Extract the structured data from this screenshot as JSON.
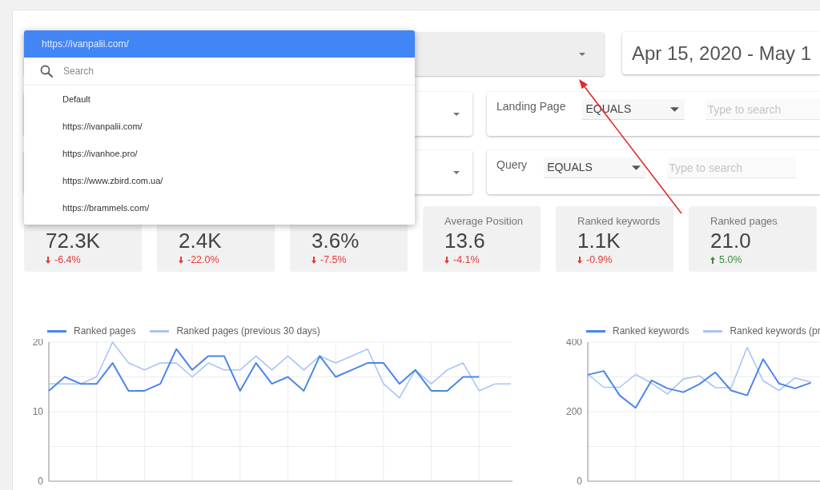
{
  "site_dropdown": {
    "current": "https://ivanpalii.com/",
    "search": {
      "placeholder": "Search"
    },
    "items": [
      "Default",
      "https://ivanpalii.com/",
      "https://ivanhoe.pro/",
      "https://www.zbird.com.ua/",
      "https://brammels.com/"
    ]
  },
  "date_range": {
    "value": "Apr 15, 2020 - May 1"
  },
  "filters": [
    {
      "label": "Landing Page",
      "operator": "EQUALS",
      "placeholder": "Type to search"
    },
    {
      "label": "Query",
      "operator": "EQUALS",
      "placeholder": "Type to search"
    }
  ],
  "kpis": [
    {
      "value": "72.3K",
      "change": "-6.4%",
      "falling": true
    },
    {
      "value": "2.4K",
      "change": "-22.0%",
      "falling": true
    },
    {
      "value": "3.6%",
      "change": "-7.5%",
      "falling": true
    },
    {
      "label": "Average Position",
      "value": "13.6",
      "change": "-4.1%",
      "falling": true
    },
    {
      "label": "Ranked keywords",
      "value": "1.1K",
      "change": "-0.9%",
      "falling": true
    },
    {
      "label": "Ranked pages",
      "value": "21.0",
      "change": "5.0%",
      "falling": false
    }
  ],
  "charts": [
    {
      "chart_data": {
        "type": "line",
        "grid": true,
        "legend": true,
        "ylim": [
          0,
          20
        ],
        "yticks": [
          0,
          10,
          20
        ],
        "series": [
          {
            "name": "Ranked pages",
            "color": "#4a86e8",
            "values": [
              13,
              15,
              14,
              14,
              17,
              13,
              13,
              14,
              19,
              16,
              18,
              18,
              13,
              17,
              14,
              15,
              13,
              18,
              15,
              16,
              17,
              17,
              14,
              16,
              13,
              13,
              15,
              15,
              null,
              null
            ]
          },
          {
            "name": "Ranked pages (previous 30 days)",
            "color": "#a9c5f5",
            "values": [
              14,
              14,
              14,
              15,
              20,
              17,
              16,
              17,
              17,
              15,
              17,
              16,
              16,
              18,
              16,
              18,
              16,
              18,
              17,
              18,
              19,
              14,
              12,
              16,
              14,
              16,
              17,
              13,
              14,
              14
            ]
          }
        ]
      }
    },
    {
      "chart_data": {
        "type": "line",
        "grid": true,
        "legend": true,
        "ylim": [
          0,
          400
        ],
        "yticks": [
          0,
          200,
          400
        ],
        "series": [
          {
            "name": "Ranked keywords",
            "color": "#4a86e8",
            "values": [
              306,
              317,
              247,
              211,
              290,
              267,
              256,
              279,
              313,
              261,
              247,
              351,
              281,
              267,
              283
            ]
          },
          {
            "name": "Ranked keywords (pr",
            "color": "#a9c5f5",
            "values": [
              308,
              270,
              270,
              307,
              282,
              251,
              294,
              303,
              269,
              269,
              385,
              289,
              261,
              297,
              285
            ]
          }
        ]
      }
    }
  ]
}
